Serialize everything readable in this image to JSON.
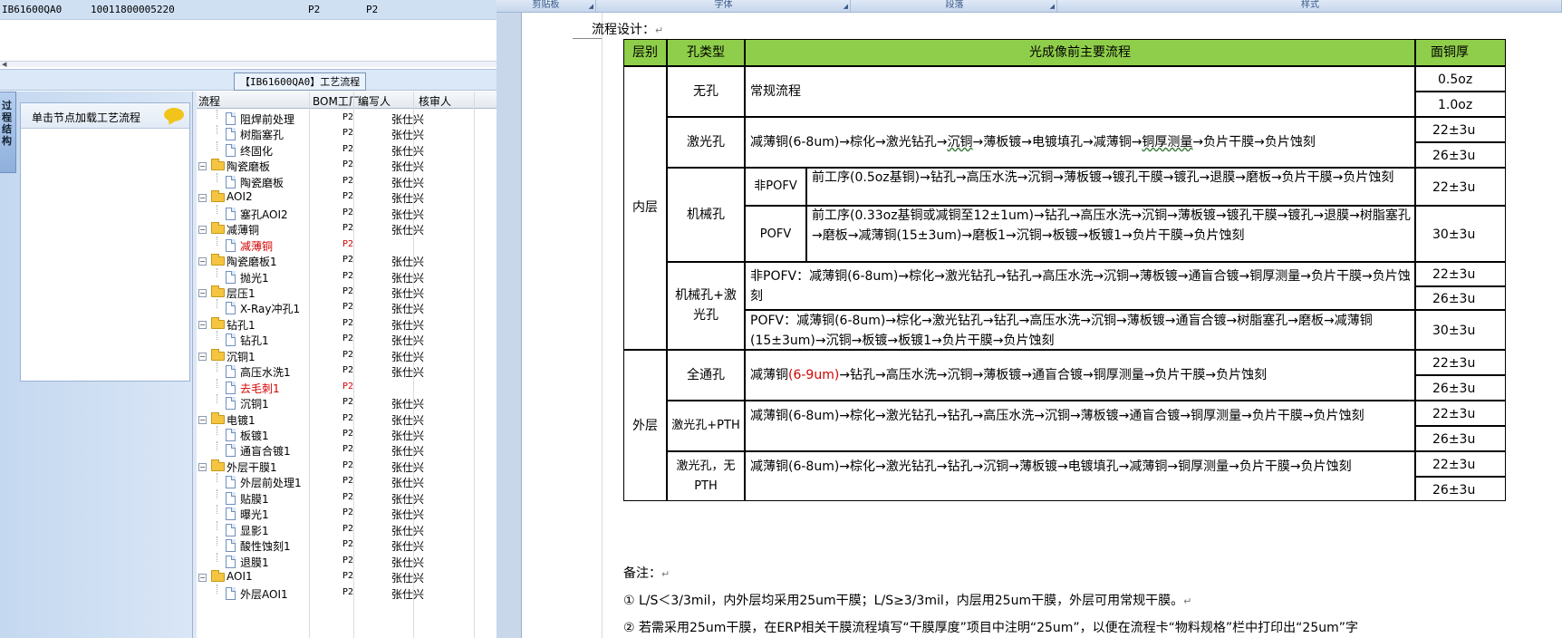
{
  "erp": {
    "top_row": {
      "part_no": "IB61600QA0",
      "order_no": "10011800005220",
      "bom_a": "P2",
      "bom_b": "P2"
    },
    "caption": "【IB61600QA0】工艺流程",
    "side_tab": "过程结构",
    "node_panel_title": "单击节点加载工艺流程",
    "grid_headers": {
      "flow": "流程",
      "bom": "BOM工厂",
      "author": "编写人",
      "reviewer": "核审人"
    },
    "rows": [
      {
        "level": 2,
        "type": "doc",
        "name": "阻焊前处理",
        "bom": "P2",
        "author": "张仕兴",
        "red": false
      },
      {
        "level": 2,
        "type": "doc",
        "name": "树脂塞孔",
        "bom": "P2",
        "author": "张仕兴",
        "red": false
      },
      {
        "level": 2,
        "type": "doc",
        "name": "终固化",
        "bom": "P2",
        "author": "张仕兴",
        "red": false
      },
      {
        "level": 1,
        "type": "folder",
        "name": "陶瓷磨板",
        "bom": "P2",
        "author": "张仕兴",
        "red": false
      },
      {
        "level": 2,
        "type": "doc",
        "name": "陶瓷磨板",
        "bom": "P2",
        "author": "张仕兴",
        "red": false
      },
      {
        "level": 1,
        "type": "folder",
        "name": "AOI2",
        "bom": "P2",
        "author": "张仕兴",
        "red": false
      },
      {
        "level": 2,
        "type": "doc",
        "name": "塞孔AOI2",
        "bom": "P2",
        "author": "张仕兴",
        "red": false
      },
      {
        "level": 1,
        "type": "folder",
        "name": "减薄铜",
        "bom": "P2",
        "author": "张仕兴",
        "red": false
      },
      {
        "level": 2,
        "type": "doc",
        "name": "减薄铜",
        "bom": "P2",
        "author": "",
        "red": true
      },
      {
        "level": 1,
        "type": "folder",
        "name": "陶瓷磨板1",
        "bom": "P2",
        "author": "张仕兴",
        "red": false
      },
      {
        "level": 2,
        "type": "doc",
        "name": "抛光1",
        "bom": "P2",
        "author": "张仕兴",
        "red": false
      },
      {
        "level": 1,
        "type": "folder",
        "name": "层压1",
        "bom": "P2",
        "author": "张仕兴",
        "red": false
      },
      {
        "level": 2,
        "type": "doc",
        "name": "X-Ray冲孔1",
        "bom": "P2",
        "author": "张仕兴",
        "red": false
      },
      {
        "level": 1,
        "type": "folder",
        "name": "钻孔1",
        "bom": "P2",
        "author": "张仕兴",
        "red": false
      },
      {
        "level": 2,
        "type": "doc",
        "name": "钻孔1",
        "bom": "P2",
        "author": "张仕兴",
        "red": false
      },
      {
        "level": 1,
        "type": "folder",
        "name": "沉铜1",
        "bom": "P2",
        "author": "张仕兴",
        "red": false
      },
      {
        "level": 2,
        "type": "doc",
        "name": "高压水洗1",
        "bom": "P2",
        "author": "张仕兴",
        "red": false
      },
      {
        "level": 2,
        "type": "doc",
        "name": "去毛刺1",
        "bom": "P2",
        "author": "",
        "red": true
      },
      {
        "level": 2,
        "type": "doc",
        "name": "沉铜1",
        "bom": "P2",
        "author": "张仕兴",
        "red": false
      },
      {
        "level": 1,
        "type": "folder",
        "name": "电镀1",
        "bom": "P2",
        "author": "张仕兴",
        "red": false
      },
      {
        "level": 2,
        "type": "doc",
        "name": "板镀1",
        "bom": "P2",
        "author": "张仕兴",
        "red": false
      },
      {
        "level": 2,
        "type": "doc",
        "name": "通盲合镀1",
        "bom": "P2",
        "author": "张仕兴",
        "red": false
      },
      {
        "level": 1,
        "type": "folder",
        "name": "外层干膜1",
        "bom": "P2",
        "author": "张仕兴",
        "red": false
      },
      {
        "level": 2,
        "type": "doc",
        "name": "外层前处理1",
        "bom": "P2",
        "author": "张仕兴",
        "red": false
      },
      {
        "level": 2,
        "type": "doc",
        "name": "贴膜1",
        "bom": "P2",
        "author": "张仕兴",
        "red": false
      },
      {
        "level": 2,
        "type": "doc",
        "name": "曝光1",
        "bom": "P2",
        "author": "张仕兴",
        "red": false
      },
      {
        "level": 2,
        "type": "doc",
        "name": "显影1",
        "bom": "P2",
        "author": "张仕兴",
        "red": false
      },
      {
        "level": 2,
        "type": "doc",
        "name": "酸性蚀刻1",
        "bom": "P2",
        "author": "张仕兴",
        "red": false
      },
      {
        "level": 2,
        "type": "doc",
        "name": "退膜1",
        "bom": "P2",
        "author": "张仕兴",
        "red": false
      },
      {
        "level": 1,
        "type": "folder",
        "name": "AOI1",
        "bom": "P2",
        "author": "张仕兴",
        "red": false
      },
      {
        "level": 2,
        "type": "doc",
        "name": "外层AOI1",
        "bom": "P2",
        "author": "张仕兴",
        "red": false
      }
    ]
  },
  "word": {
    "ribbon": {
      "clipboard": "剪贴板",
      "font": "字体",
      "paragraph": "段落",
      "styles": "样式"
    },
    "flow_title": "流程设计：",
    "table": {
      "headers": {
        "level": "层别",
        "hole_type": "孔类型",
        "main_flow": "光成像前主要流程",
        "surface_cu": "面铜厚"
      },
      "inner_label": "内层",
      "outer_label": "外层",
      "none_hole": "无孔",
      "regular_flow": "常规流程",
      "cu_05": "0.5oz",
      "cu_10": "1.0oz",
      "laser_hole": "激光孔",
      "laser_flow_a": "减薄铜(6-8um)→棕化→激光钻孔→",
      "laser_flow_b": "沉铜",
      "laser_flow_c": "→薄板镀→电镀填孔→减薄铜→",
      "laser_flow_d": "铜厚测量",
      "laser_flow_e": "→负片干膜→负片蚀刻",
      "cu_22": "22±3u",
      "cu_26": "26±3u",
      "cu_30": "30±3u",
      "mech_hole": "机械孔",
      "non_pofv": "非POFV",
      "pofv": "POFV",
      "mech_nonpofv_flow": "前工序(0.5oz基铜)→钻孔→高压水洗→沉铜→薄板镀→镀孔干膜→镀孔→退膜→磨板→负片干膜→负片蚀刻",
      "mech_pofv_flow": "前工序(0.33oz基铜或减铜至12±1um)→钻孔→高压水洗→沉铜→薄板镀→镀孔干膜→镀孔→退膜→树脂塞孔→磨板→减薄铜(15±3um)→磨板1→沉铜→板镀→板镀1→负片干膜→负片蚀刻",
      "mech_laser_hole": "机械孔+激光孔",
      "mech_laser_nonpofv_flow": "非POFV：减薄铜(6-8um)→棕化→激光钻孔→钻孔→高压水洗→沉铜→薄板镀→通盲合镀→铜厚测量→负片干膜→负片蚀刻",
      "mech_laser_pofv_flow": "POFV：减薄铜(6-8um)→棕化→激光钻孔→钻孔→高压水洗→沉铜→薄板镀→通盲合镀→树脂塞孔→磨板→减薄铜(15±3um)→沉铜→板镀→板镀1→负片干膜→负片蚀刻",
      "through_hole": "全通孔",
      "through_flow_a": "减薄铜",
      "through_flow_red": "(6-9um)",
      "through_flow_b": "→钻孔→高压水洗→沉铜→薄板镀→通盲合镀→铜厚测量→负片干膜→负片蚀刻",
      "laser_pth_hole": "激光孔+PTH",
      "laser_pth_flow": "减薄铜(6-8um)→棕化→激光钻孔→钻孔→高压水洗→沉铜→薄板镀→通盲合镀→铜厚测量→负片干膜→负片蚀刻",
      "laser_no_pth_hole": "激光孔，无PTH",
      "laser_no_pth_flow": "减薄铜(6-8um)→棕化→激光钻孔→钻孔→沉铜→薄板镀→电镀填孔→减薄铜→铜厚测量→负片干膜→负片蚀刻"
    },
    "notes": {
      "title": "备注：",
      "note1": "① L/S＜3/3mil，内外层均采用25um干膜；L/S≥3/3mil，内层用25um干膜，外层可用常规干膜。",
      "note2": "② 若需采用25um干膜，在ERP相关干膜流程填写“干膜厚度”项目中注明“25um”，以便在流程卡“物料规格”栏中打印出“25um”字"
    }
  }
}
